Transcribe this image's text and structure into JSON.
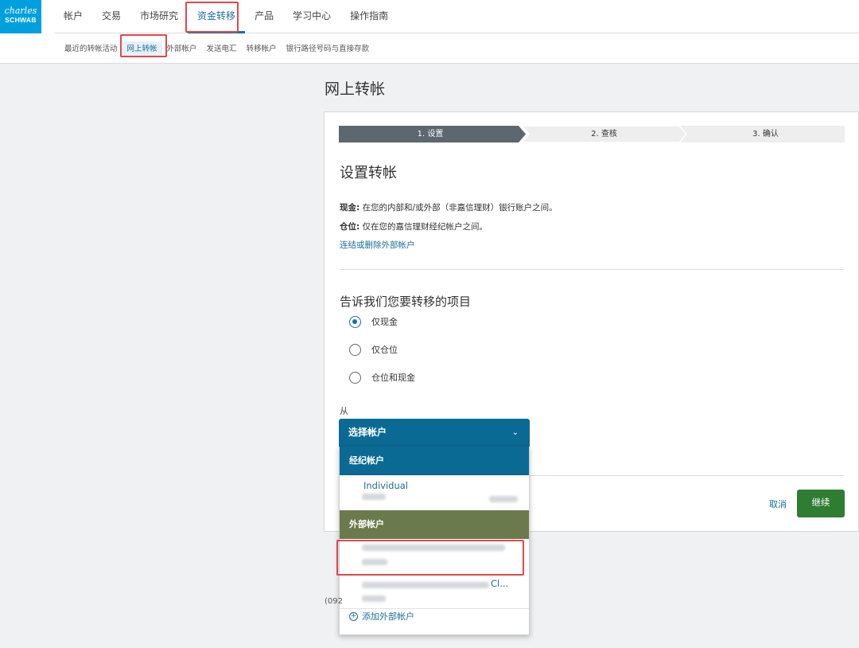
{
  "logo": {
    "line1": "charles",
    "line2": "SCHWAB"
  },
  "main_nav": [
    {
      "label": "帐户"
    },
    {
      "label": "交易"
    },
    {
      "label": "市场研究"
    },
    {
      "label": "资金转移"
    },
    {
      "label": "产品"
    },
    {
      "label": "学习中心"
    },
    {
      "label": "操作指南"
    }
  ],
  "sub_nav": [
    {
      "label": "最近的转帐活动"
    },
    {
      "label": "网上转帐"
    },
    {
      "label": "外部帐户"
    },
    {
      "label": "发送电汇"
    },
    {
      "label": "转移帐户"
    },
    {
      "label": "银行路径号码与直接存款"
    }
  ],
  "page_title": "网上转帐",
  "steps": [
    {
      "label": "1. 设置",
      "state": "active"
    },
    {
      "label": "2. 查核",
      "state": "inactive"
    },
    {
      "label": "3. 确认",
      "state": "inactive"
    }
  ],
  "section_title": "设置转帐",
  "desc_cash": {
    "label": "现金:",
    "text": " 在您的内部和/或外部（非嘉信理财）银行账户之间。"
  },
  "desc_position": {
    "label": "仓位:",
    "text": " 仅在您的嘉信理财经纪帐户之间。"
  },
  "link_external": "连结或删除外部帐户",
  "question": "告诉我们您要转移的项目",
  "options": [
    {
      "label": "仅现金",
      "selected": true
    },
    {
      "label": "仅仓位",
      "selected": false
    },
    {
      "label": "仓位和现金",
      "selected": false
    }
  ],
  "from_label": "从",
  "select_label": "选择帐户",
  "dropdown": {
    "group_brokerage": "经纪帐户",
    "brokerage_item": "Individual",
    "group_external": "外部帐户",
    "external_item_2_suffix": "Cl...",
    "add_external": "添加外部帐户"
  },
  "cancel_label": "取消",
  "continue_label": "继续",
  "phone_prefix": "(092",
  "colors": {
    "accent": "#1a6e9f",
    "select_bg": "#0b6a93",
    "external_group_bg": "#6b7a4d",
    "continue_bg": "#2e7d32",
    "stepper_active": "#5c6770",
    "highlight": "#e0474c"
  }
}
